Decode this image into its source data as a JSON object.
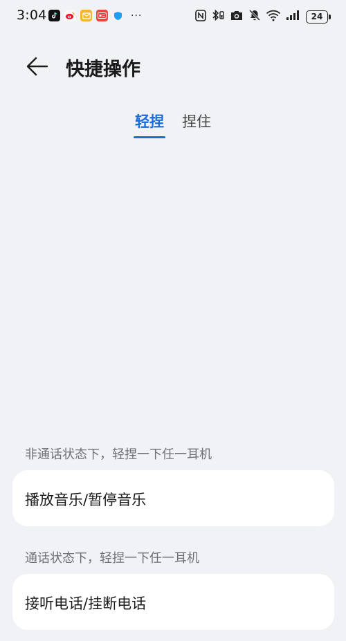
{
  "status_bar": {
    "time": "3:04",
    "more_indicator": "···",
    "battery_level": "24",
    "app_icons": [
      "tiktok-icon",
      "weibo-icon",
      "mail-icon",
      "news-icon",
      "shield-icon"
    ],
    "system_icons": [
      "nfc-icon",
      "bluetooth-icon",
      "camera-icon",
      "mute-icon",
      "wifi-icon",
      "signal-icon",
      "battery-icon"
    ]
  },
  "header": {
    "title": "快捷操作",
    "back_icon": "arrow-left-icon"
  },
  "tabs": [
    {
      "label": "轻捏",
      "active": true
    },
    {
      "label": "捏住",
      "active": false
    }
  ],
  "sections": [
    {
      "label": "非通话状态下，轻捏一下任一耳机",
      "value": "播放音乐/暂停音乐"
    },
    {
      "label": "通话状态下，轻捏一下任一耳机",
      "value": "接听电话/挂断电话"
    }
  ],
  "colors": {
    "accent": "#1b6bd8",
    "background": "#f1f2f6",
    "card": "#ffffff",
    "secondary_text": "#6f7075"
  }
}
